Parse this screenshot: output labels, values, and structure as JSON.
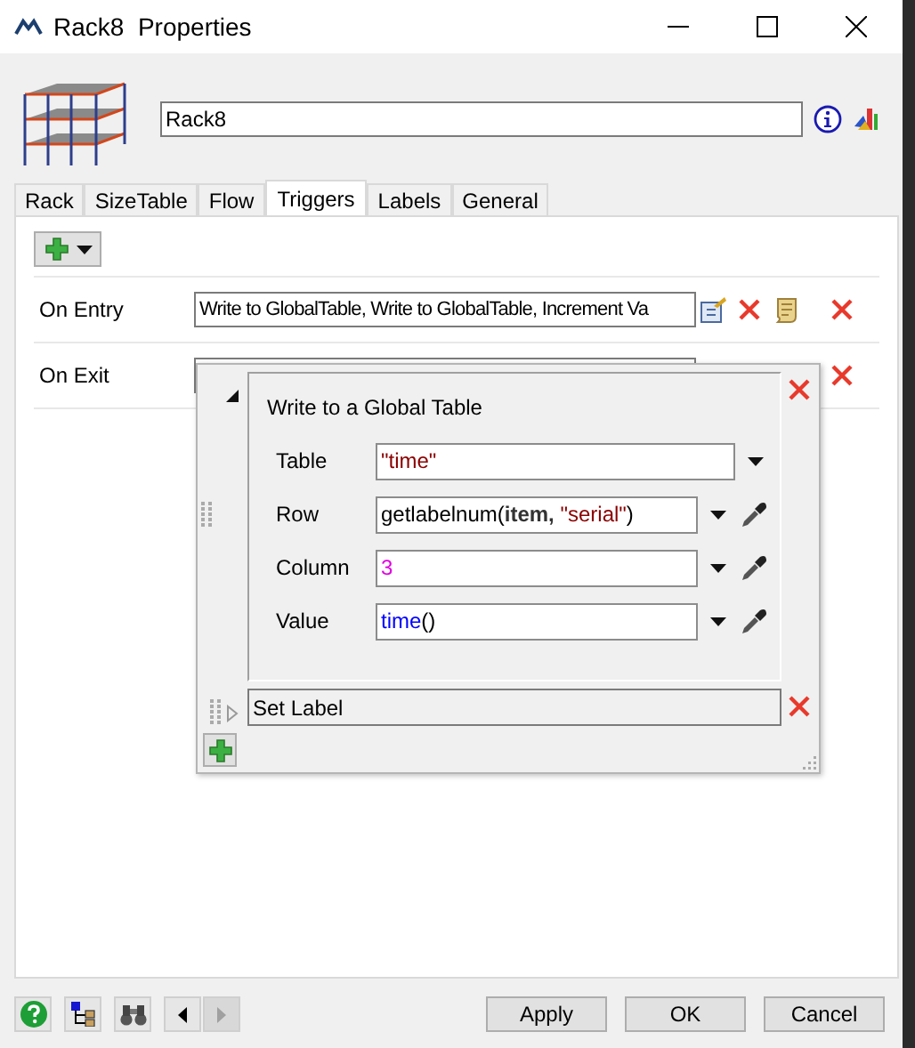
{
  "window": {
    "title": "Rack8  Properties"
  },
  "object_name": {
    "value": "Rack8"
  },
  "tabs": [
    {
      "label": "Rack",
      "selected": false
    },
    {
      "label": "SizeTable",
      "selected": false
    },
    {
      "label": "Flow",
      "selected": false
    },
    {
      "label": "Triggers",
      "selected": true
    },
    {
      "label": "Labels",
      "selected": false
    },
    {
      "label": "General",
      "selected": false
    }
  ],
  "triggers": [
    {
      "label": "On Entry",
      "value": "Write to GlobalTable, Write to GlobalTable, Increment Va"
    },
    {
      "label": "On Exit"
    }
  ],
  "popup": {
    "items": [
      {
        "title": "Write to a Global Table",
        "expanded": true,
        "params": [
          {
            "label": "Table",
            "picker": false,
            "segments": [
              {
                "text": "\"time\"",
                "kind": "string"
              }
            ]
          },
          {
            "label": "Row",
            "picker": true,
            "segments": [
              {
                "text": "getlabelnum(",
                "kind": "plain"
              },
              {
                "text": "item, ",
                "kind": "keyword"
              },
              {
                "text": "\"serial\"",
                "kind": "string"
              },
              {
                "text": ")",
                "kind": "plain"
              }
            ]
          },
          {
            "label": "Column",
            "picker": true,
            "segments": [
              {
                "text": "3",
                "kind": "number"
              }
            ]
          },
          {
            "label": "Value",
            "picker": true,
            "segments": [
              {
                "text": "time",
                "kind": "function"
              },
              {
                "text": "()",
                "kind": "plain"
              }
            ]
          }
        ]
      },
      {
        "title": "Set Label",
        "expanded": false
      }
    ]
  },
  "nav": {
    "back_disabled": false,
    "forward_disabled": true
  },
  "buttons": [
    "Apply",
    "OK",
    "Cancel"
  ]
}
